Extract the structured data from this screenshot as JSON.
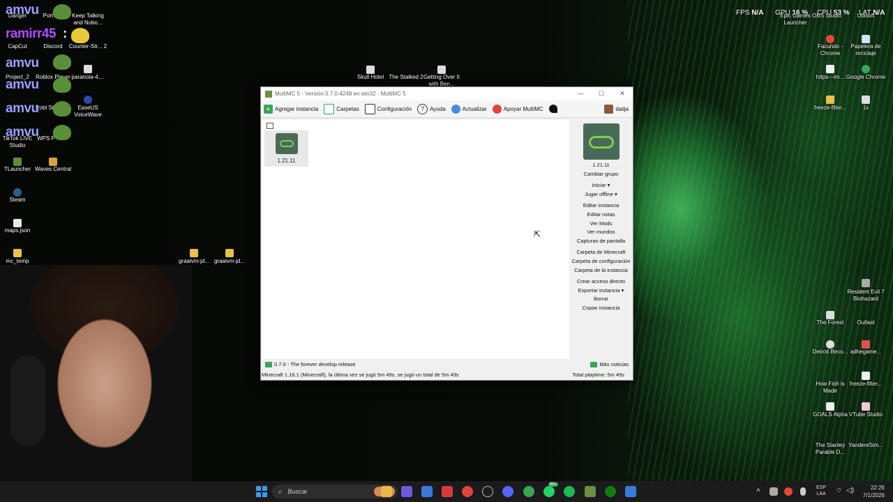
{
  "desktop": {
    "left_icons": [
      {
        "label": "Danger"
      },
      {
        "label": "Port"
      },
      {
        "label": "Keep Talking and Nobo..."
      },
      {
        "label": "CapCut"
      },
      {
        "label": "Discord"
      },
      {
        "label": "Counter-Str... 2"
      },
      {
        "label": "Project_2"
      },
      {
        "label": "Roblox Player"
      },
      {
        "label": "paranoia-4...."
      },
      {
        "label": "Robl Stu"
      },
      {
        "label": "EaseUS VoiceWave"
      },
      {
        "label": "TikTok LIVE Studio"
      },
      {
        "label": "WPS P"
      },
      {
        "label": "TLauncher"
      },
      {
        "label": "Waves Central"
      },
      {
        "label": "Steam"
      },
      {
        "label": "maps.json"
      },
      {
        "label": "mc_temp"
      },
      {
        "label": "graalvm-jd..."
      },
      {
        "label": "graalvm-jd..."
      },
      {
        "label": "Skull Hotel"
      },
      {
        "label": "The Stalked 2"
      },
      {
        "label": "Getting Over It with Ben..."
      }
    ],
    "right_icons": [
      {
        "label": "Epic Games Launcher"
      },
      {
        "label": "OBS Studio"
      },
      {
        "label": "Ubisoft"
      },
      {
        "label": "Facundo - Chrome"
      },
      {
        "label": "Papelera de reciclaje"
      },
      {
        "label": "https---im..."
      },
      {
        "label": "Google Chrome"
      },
      {
        "label": "freeze-filter..."
      },
      {
        "label": "1x"
      },
      {
        "label": "Resident Evil 7 Biohazard"
      },
      {
        "label": "The Forest"
      },
      {
        "label": "Outlast"
      },
      {
        "label": "Detroit Beco..."
      },
      {
        "label": "adhegame..."
      },
      {
        "label": "How Fish is Made"
      },
      {
        "label": "freeze-filter..."
      },
      {
        "label": "GOALS Alpha"
      },
      {
        "label": "VTube Studio"
      },
      {
        "label": "The Stanley Parable D..."
      },
      {
        "label": "YandereSim..."
      }
    ],
    "overlays": [
      "amvu",
      "ramirr45",
      "amvu",
      "amvu",
      "amvu",
      "amvu"
    ],
    "colon": ":",
    "stats": {
      "fps_label": "FPS",
      "fps_value": "N/A",
      "gpu_label": "GPU",
      "gpu_value": "16 %",
      "cpu_label": "CPU",
      "cpu_value": "53 %",
      "lat_label": "LAT",
      "lat_value": "N/A"
    }
  },
  "window": {
    "title": "MultiMC 5 - Versión 0.7.0-4248 en win32 - MultiMC 5",
    "controls": {
      "minimize": "—",
      "maximize": "☐",
      "close": "✕"
    },
    "toolbar": {
      "add_instance": "Agregar instancia",
      "folders": "Carpetas",
      "settings": "Configuración",
      "help": "Ayuda",
      "update": "Actualizar",
      "support": "Apoyar MultiMC",
      "account": "daiija"
    },
    "instance": {
      "name": "1.21.11"
    },
    "sidebar": {
      "instance_name": "1.21.11",
      "change_group": "Cambiar grupo",
      "launch": "Iniciar",
      "launch_offline": "Jugar offline",
      "actions": [
        "Editar instancia",
        "Editar notas",
        "Ver Mods",
        "Ver mundos",
        "Capturas de pantalla"
      ],
      "folder_actions": [
        "Carpeta de Minecraft",
        "Carpeta de configuración",
        "Carpeta de la instancia"
      ],
      "shortcut": "Crear acceso directo",
      "export": "Exportar instancia",
      "delete": "Borrar",
      "copy": "Copiar instancia"
    },
    "status": {
      "news": "0.7.0 - The forever develop release",
      "more_news": "Más noticias",
      "last_played": "Minecraft 1.16.1 (Minecraft), la última vez se jugó 5m 49s, se jugó un total de 5m 49s",
      "total_playtime": "Total playtime: 5m 49s"
    }
  },
  "taskbar": {
    "search_placeholder": "Buscar",
    "badge": "99+",
    "lang": "ESP",
    "lang_sub": "LAA",
    "time": "22:26",
    "date": "7/1/2026"
  },
  "colors": {
    "window_bg": "#f0f0f0",
    "taskbar": "#1b1b1c",
    "multimc_green": "#6b8f45"
  }
}
